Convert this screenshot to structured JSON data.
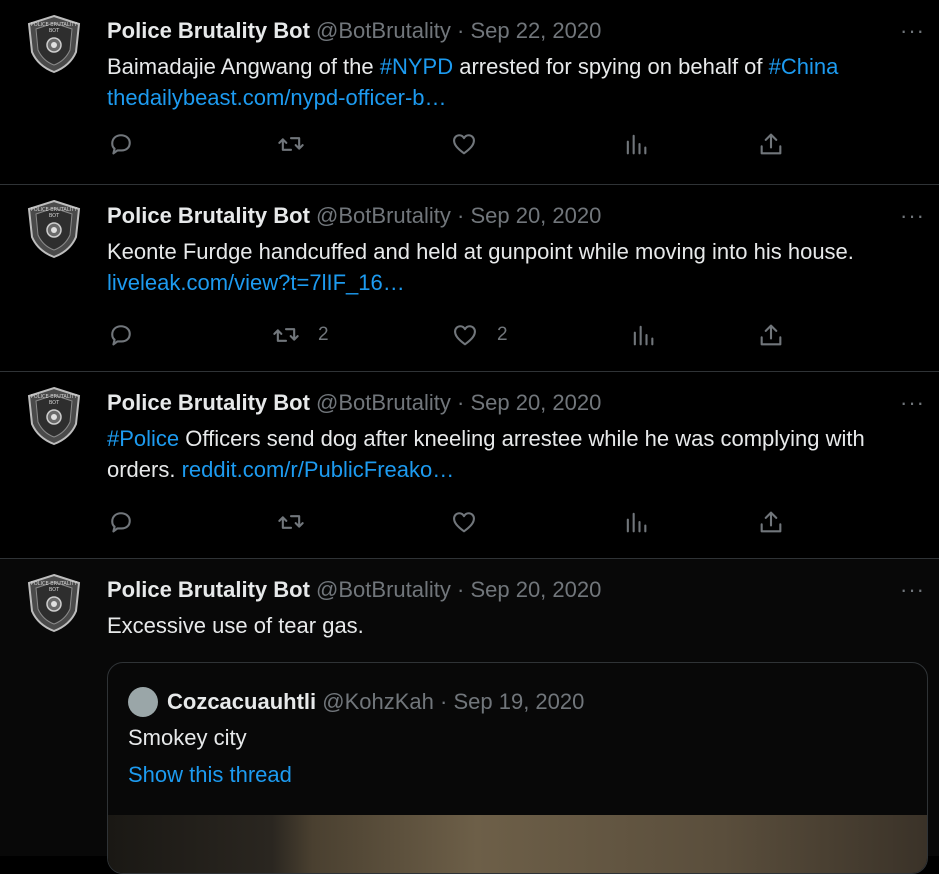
{
  "tweets": [
    {
      "name": "Police Brutality Bot",
      "handle": "@BotBrutality",
      "dot": "·",
      "date": "Sep 22, 2020",
      "more": "···",
      "segments": [
        {
          "text": "Baimadajie Angwang of the ",
          "link": false
        },
        {
          "text": "#NYPD",
          "link": true
        },
        {
          "text": " arrested for spying on behalf of ",
          "link": false
        },
        {
          "text": "#China",
          "link": true
        },
        {
          "text": " ",
          "link": false
        },
        {
          "text": "thedailybeast.com/nypd-officer-b…",
          "link": true
        }
      ],
      "reply_count": "",
      "retweet_count": "",
      "like_count": "",
      "views_count": ""
    },
    {
      "name": "Police Brutality Bot",
      "handle": "@BotBrutality",
      "dot": "·",
      "date": "Sep 20, 2020",
      "more": "···",
      "segments": [
        {
          "text": "Keonte Furdge handcuffed and held at gunpoint while moving into his house. ",
          "link": false
        },
        {
          "text": "liveleak.com/view?t=7lIF_16…",
          "link": true
        }
      ],
      "reply_count": "",
      "retweet_count": "2",
      "like_count": "2",
      "views_count": ""
    },
    {
      "name": "Police Brutality Bot",
      "handle": "@BotBrutality",
      "dot": "·",
      "date": "Sep 20, 2020",
      "more": "···",
      "segments": [
        {
          "text": "#Police",
          "link": true
        },
        {
          "text": " Officers send dog after kneeling arrestee while he was complying with orders. ",
          "link": false
        },
        {
          "text": "reddit.com/r/PublicFreako…",
          "link": true
        }
      ],
      "reply_count": "",
      "retweet_count": "",
      "like_count": "",
      "views_count": ""
    },
    {
      "name": "Police Brutality Bot",
      "handle": "@BotBrutality",
      "dot": "·",
      "date": "Sep 20, 2020",
      "more": "···",
      "segments": [
        {
          "text": "Excessive use of tear gas.",
          "link": false
        }
      ],
      "quote": {
        "name": "Cozcacuauhtli",
        "handle": "@KohzKah",
        "dot": "·",
        "date": "Sep 19, 2020",
        "text": "Smokey city",
        "thread_link": "Show this thread"
      }
    }
  ],
  "avatar": {
    "badge_text_top": "POLICE BRUTALITY",
    "badge_text_bottom": "BOT"
  },
  "colors": {
    "background": "#000000",
    "text": "#e7e9ea",
    "muted": "#71767b",
    "link": "#1d9bf0",
    "border": "#2f3336"
  },
  "icons": [
    "reply-icon",
    "retweet-icon",
    "like-icon",
    "views-icon",
    "share-icon",
    "more-icon"
  ]
}
